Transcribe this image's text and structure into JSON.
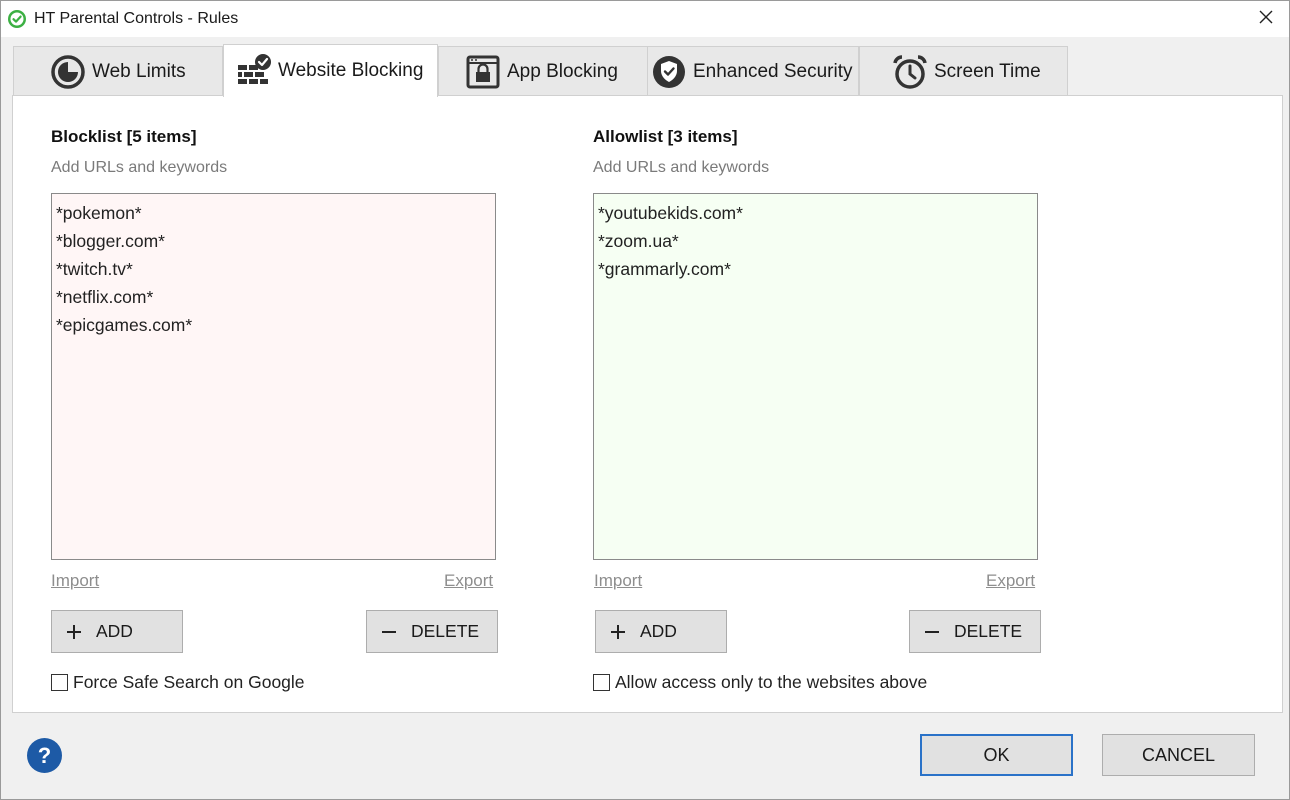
{
  "window": {
    "title": "HT Parental Controls - Rules"
  },
  "tabs": [
    {
      "label": "Web Limits",
      "icon": "pie-clock-icon"
    },
    {
      "label": "Website Blocking",
      "icon": "brick-wall-check-icon",
      "active": true
    },
    {
      "label": "App Blocking",
      "icon": "app-lock-icon"
    },
    {
      "label": "Enhanced Security",
      "icon": "shield-check-icon"
    },
    {
      "label": "Screen Time",
      "icon": "alarm-clock-icon"
    }
  ],
  "blocklist": {
    "title": "Blocklist [5 items]",
    "subtitle": "Add URLs and keywords",
    "items": [
      "*pokemon*",
      "*blogger.com*",
      "*twitch.tv*",
      "*netflix.com*",
      "*epicgames.com*"
    ],
    "import_label": "Import",
    "export_label": "Export",
    "add_label": "ADD",
    "delete_label": "DELETE",
    "checkbox_label": "Force Safe Search on Google",
    "checked": false,
    "bg_color": "#fff6f6"
  },
  "allowlist": {
    "title": "Allowlist [3 items]",
    "subtitle": "Add URLs and keywords",
    "items": [
      "*youtubekids.com*",
      "*zoom.ua*",
      "*grammarly.com*"
    ],
    "import_label": "Import",
    "export_label": "Export",
    "add_label": "ADD",
    "delete_label": "DELETE",
    "checkbox_label": "Allow access only to the websites above",
    "checked": false,
    "bg_color": "#f6fff3"
  },
  "footer": {
    "help_label": "?",
    "ok_label": "OK",
    "cancel_label": "CANCEL"
  },
  "colors": {
    "accent": "#2a72c8",
    "help": "#1d5aa6",
    "app_icon": "#3cb043"
  }
}
